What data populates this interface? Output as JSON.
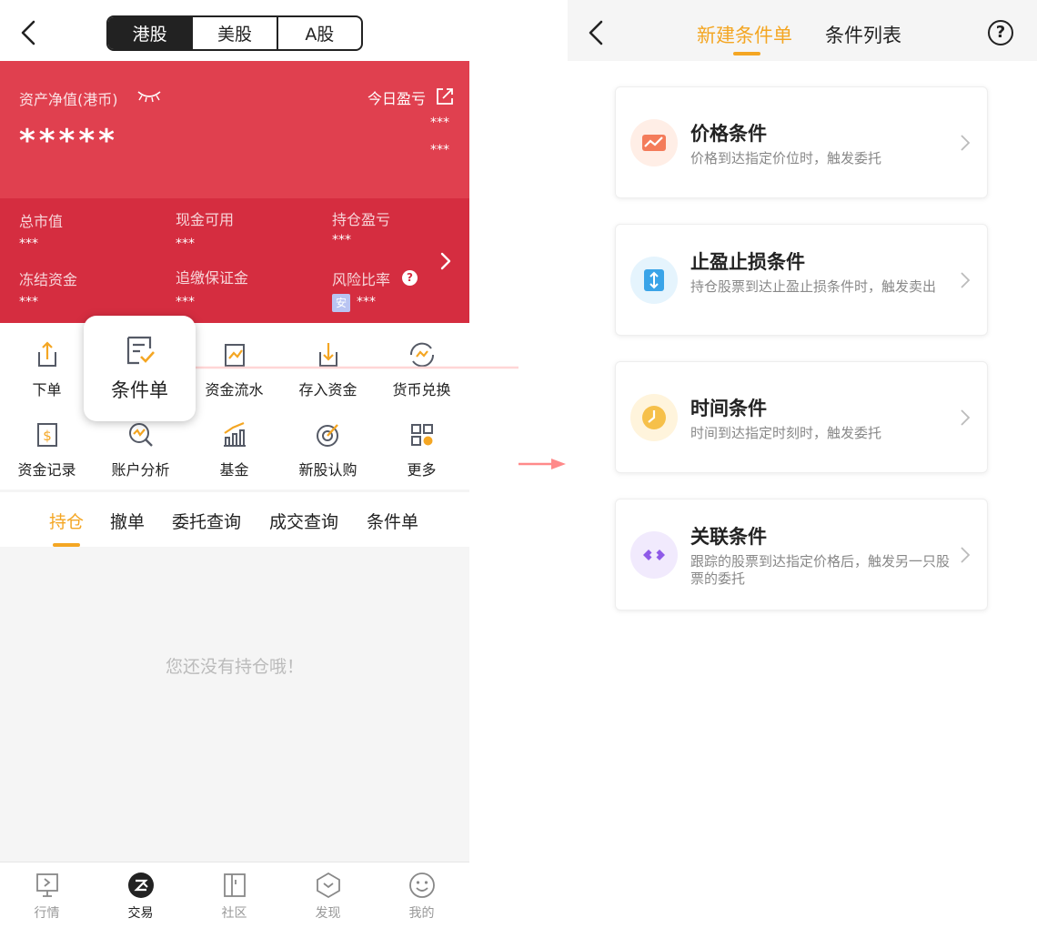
{
  "left": {
    "header": {
      "market_tabs": [
        {
          "label": "港股"
        },
        {
          "label": "美股"
        },
        {
          "label": "A股"
        }
      ]
    },
    "asset": {
      "label": "资产净值(港币)",
      "value": "*****",
      "today_pl_label": "今日盈亏",
      "today_pl_value": "***",
      "today_pl_rate": "***"
    },
    "stats": [
      {
        "label": "总市值",
        "value": "***"
      },
      {
        "label": "现金可用",
        "value": "***"
      },
      {
        "label": "持仓盈亏",
        "value": "***"
      },
      {
        "label": "冻结资金",
        "value": "***"
      },
      {
        "label": "追缴保证金",
        "value": "***"
      },
      {
        "label": "风险比率",
        "value": "***",
        "badge": "安"
      }
    ],
    "functions": [
      {
        "label": "下单"
      },
      {
        "label": "条件单"
      },
      {
        "label": "资金流水"
      },
      {
        "label": "存入资金"
      },
      {
        "label": "货币兑换"
      },
      {
        "label": "资金记录"
      },
      {
        "label": "账户分析"
      },
      {
        "label": "基金"
      },
      {
        "label": "新股认购"
      },
      {
        "label": "更多"
      }
    ],
    "tabs": [
      {
        "label": "持仓"
      },
      {
        "label": "撤单"
      },
      {
        "label": "委托查询"
      },
      {
        "label": "成交查询"
      },
      {
        "label": "条件单"
      }
    ],
    "empty_text": "您还没有持仓哦！",
    "bottom_nav": [
      {
        "label": "行情"
      },
      {
        "label": "交易"
      },
      {
        "label": "社区"
      },
      {
        "label": "发现"
      },
      {
        "label": "我的"
      }
    ],
    "help_glyph": "?"
  },
  "right": {
    "tabs": [
      {
        "label": "新建条件单"
      },
      {
        "label": "条件列表"
      }
    ],
    "help_glyph": "?",
    "cards": [
      {
        "title": "价格条件",
        "desc": "价格到达指定价位时，触发委托"
      },
      {
        "title": "止盈止损条件",
        "desc": "持仓股票到达止盈止损条件时，触发卖出"
      },
      {
        "title": "时间条件",
        "desc": "时间到达指定时刻时，触发委托"
      },
      {
        "title": "关联条件",
        "desc": "跟踪的股票到达指定价格后，触发另一只股票的委托"
      }
    ]
  },
  "colors": {
    "accent": "#f4a623",
    "asset_red": "#e0404f",
    "stats_red": "#d52d40"
  }
}
